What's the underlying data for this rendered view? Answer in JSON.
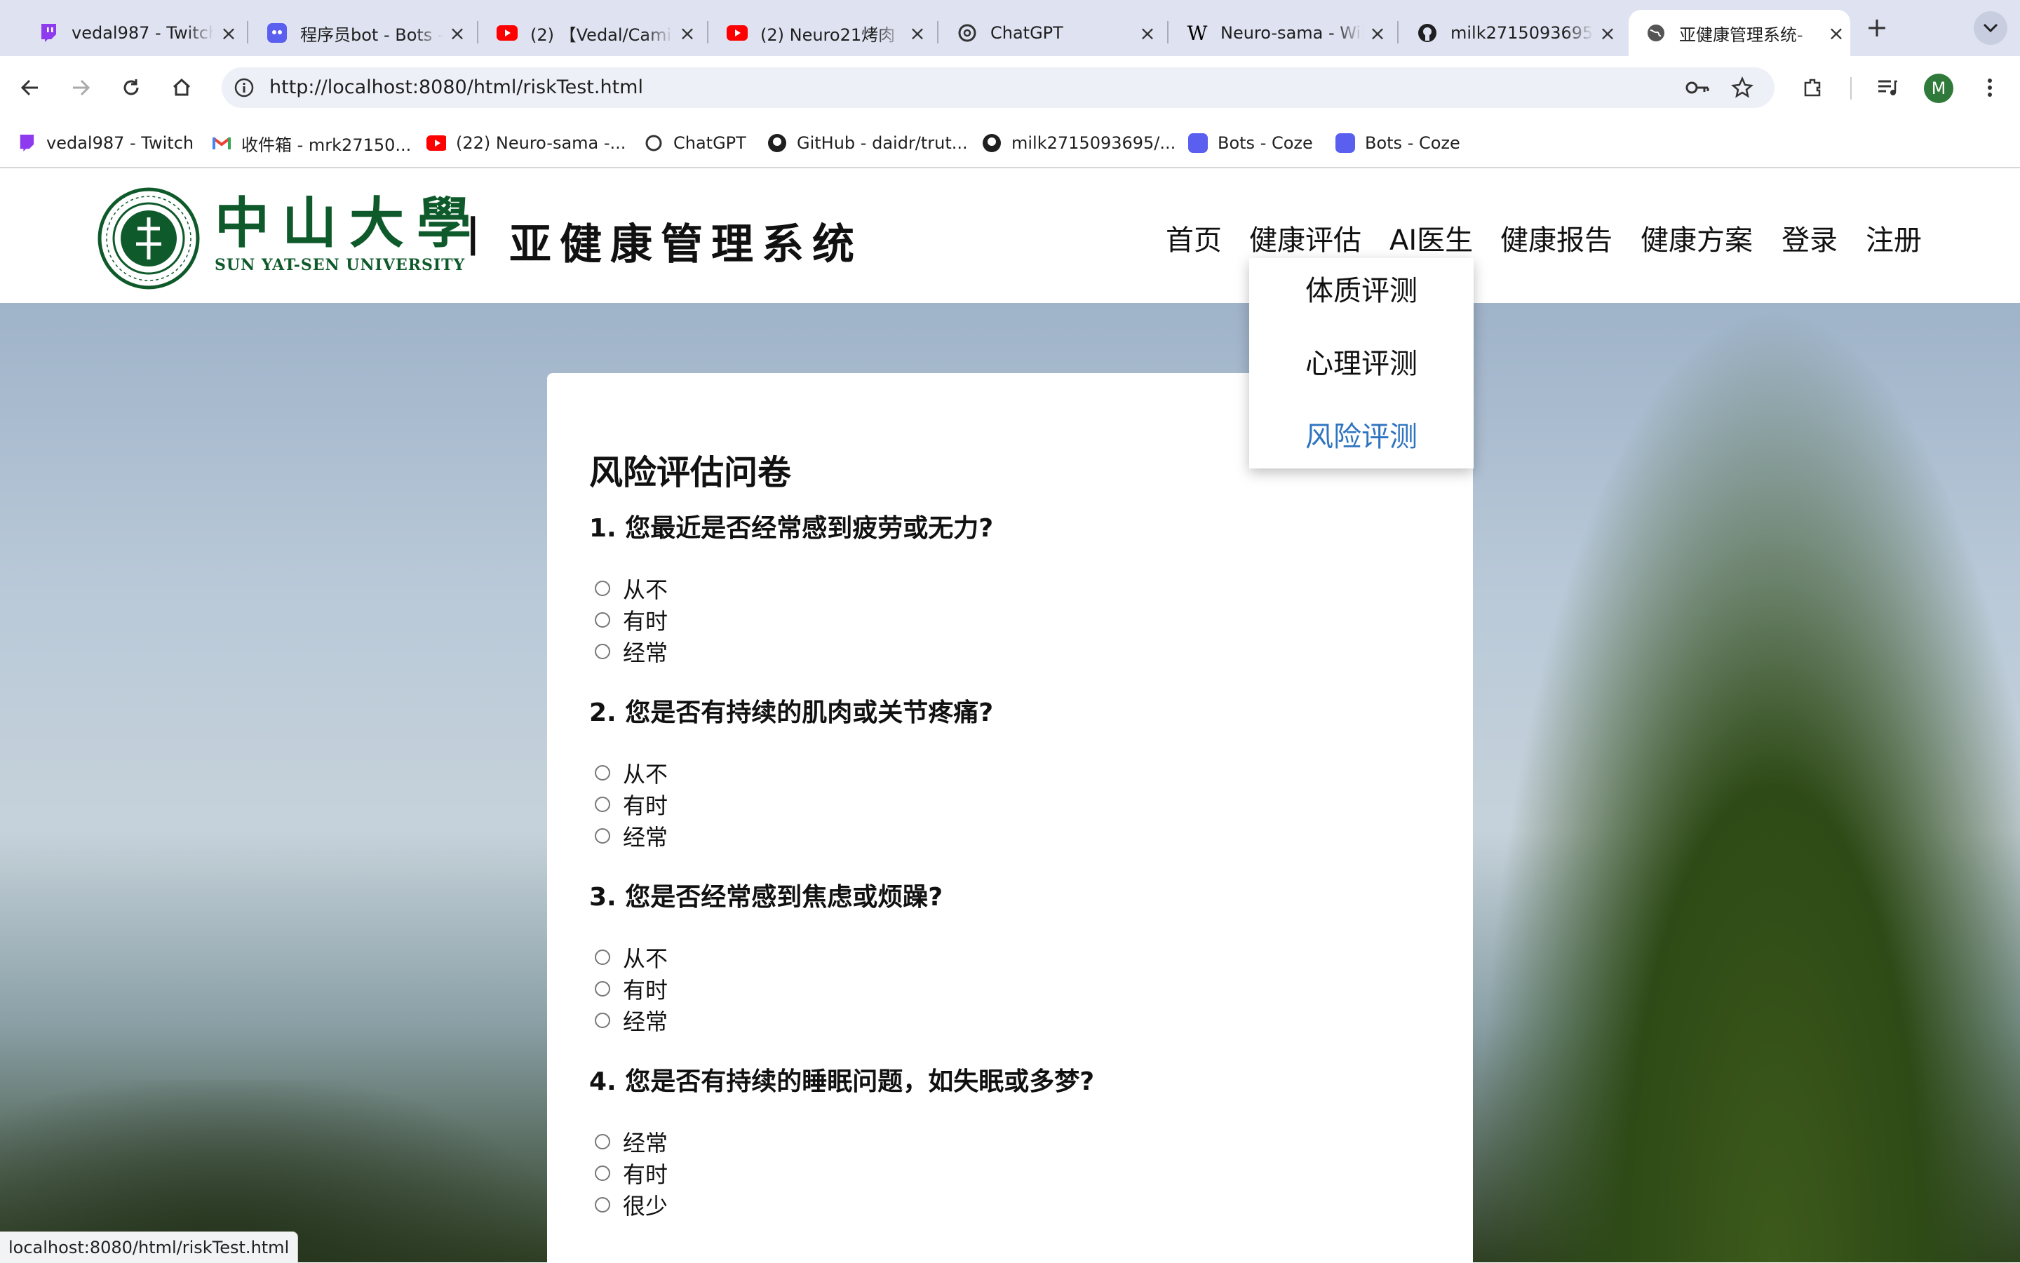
{
  "browser": {
    "tabs": [
      {
        "title": "vedal987 - Twitch",
        "icon": "twitch-icon"
      },
      {
        "title": "程序员bot - Bots - Coze",
        "icon": "coze-icon"
      },
      {
        "title": "(2) 【Vedal/Camila】",
        "icon": "youtube-icon"
      },
      {
        "title": "(2) Neuro21烤肉",
        "icon": "youtube-icon"
      },
      {
        "title": "ChatGPT",
        "icon": "openai-icon"
      },
      {
        "title": "Neuro-sama - Wikipedia",
        "icon": "wikipedia-icon"
      },
      {
        "title": "milk2715093695",
        "icon": "github-icon"
      },
      {
        "title": "亚健康管理系统-",
        "icon": "globe-icon",
        "active": true
      }
    ],
    "url": "http://localhost:8080/html/riskTest.html",
    "profile_initial": "M",
    "bookmarks": [
      {
        "label": "vedal987 - Twitch",
        "icon": "twitch-icon"
      },
      {
        "label": "收件箱 - mrk27150...",
        "icon": "gmail-icon"
      },
      {
        "label": "(22) Neuro-sama -...",
        "icon": "youtube-icon"
      },
      {
        "label": "ChatGPT",
        "icon": "openai-icon"
      },
      {
        "label": "GitHub - daidr/trut...",
        "icon": "github-icon"
      },
      {
        "label": "milk2715093695/...",
        "icon": "github-icon"
      },
      {
        "label": "Bots - Coze",
        "icon": "coze-icon"
      },
      {
        "label": "Bots - Coze",
        "icon": "coze-icon"
      }
    ],
    "status_text": "localhost:8080/html/riskTest.html"
  },
  "site": {
    "logo_cn": "中山大學",
    "logo_en": "SUN  YAT-SEN UNIVERSITY",
    "divider": "|",
    "system_title": "亚健康管理系统",
    "nav": [
      "首页",
      "健康评估",
      "AI医生",
      "健康报告",
      "健康方案",
      "登录",
      "注册"
    ],
    "dropdown": [
      "体质评测",
      "心理评测",
      "风险评测"
    ],
    "dropdown_selected": "风险评测"
  },
  "questionnaire": {
    "title": "风险评估问卷",
    "questions": [
      {
        "text": "1. 您最近是否经常感到疲劳或无力?",
        "options": [
          "从不",
          "有时",
          "经常"
        ]
      },
      {
        "text": "2. 您是否有持续的肌肉或关节疼痛?",
        "options": [
          "从不",
          "有时",
          "经常"
        ]
      },
      {
        "text": "3. 您是否经常感到焦虑或烦躁?",
        "options": [
          "从不",
          "有时",
          "经常"
        ]
      },
      {
        "text": "4. 您是否有持续的睡眠问题，如失眠或多梦?",
        "options": [
          "经常",
          "有时",
          "很少"
        ]
      }
    ]
  },
  "colors": {
    "accent": "#2f74c0",
    "brand_green": "#0f5a2b",
    "tab_strip": "#dfe3f1"
  }
}
